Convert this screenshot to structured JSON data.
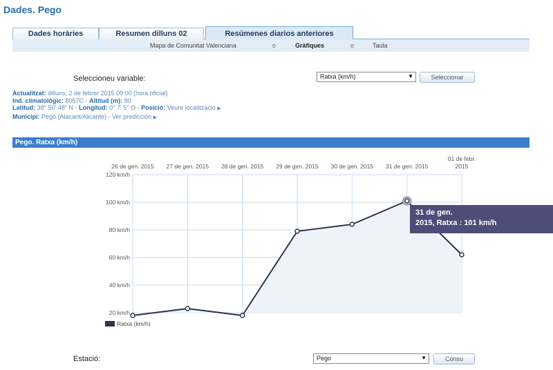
{
  "page_title": "Dades. Pego",
  "tabs": [
    {
      "label": "Dades horàries",
      "active": false
    },
    {
      "label": "Resumen dilluns 02",
      "active": false
    },
    {
      "label": "Resúmenes diarios anteriores",
      "active": true
    }
  ],
  "subnav": {
    "items": [
      "Mapa de Comunitat Valenciana",
      "Gràfiques",
      "Taula"
    ],
    "separator": "o",
    "current": "Gràfiques"
  },
  "variable_selector": {
    "label": "Seleccioneu variable:",
    "selected": "Ratxa (km/h)",
    "button": "Seleccionar"
  },
  "station_info": {
    "updated_label": "Actualitzat:",
    "updated_value": "dilluns, 2 de febrer 2015 09:00 (hora oficial)",
    "ind_label": "Ind. climatològic:",
    "ind_value": "8057C",
    "alt_label": "Altitud (m):",
    "alt_value": "80",
    "lat_label": "Latitud:",
    "lat_value": "38° 50' 48\" N",
    "lon_label": "Longitud:",
    "lon_value": "0° 7' 5\" O",
    "pos_label": "Posició:",
    "pos_link": "Veure localització",
    "muni_label": "Municipi:",
    "muni_value": "Pego (Alacant/Alicante)",
    "pred_link": "Ver predicción",
    "dash": "-"
  },
  "chart_section_title": "Pego. Ratxa (km/h)",
  "chart_data": {
    "type": "line",
    "categories": [
      "26 de gen. 2015",
      "27 de gen. 2015",
      "28 de gen. 2015",
      "29 de gen. 2015",
      "30 de gen. 2015",
      "31 de gen. 2015",
      "01 de febr. 2015"
    ],
    "series": [
      {
        "name": "Ratxa (km/h)",
        "values": [
          18,
          23,
          18,
          79,
          84,
          101,
          62
        ]
      }
    ],
    "ylim": [
      20,
      120
    ],
    "yticks": [
      "20 km/h",
      "40 km/h",
      "60 km/h",
      "80 km/h",
      "100 km/h",
      "120 km/h"
    ],
    "grid": true,
    "legend": "bottom-left",
    "line_color": "#2f3448",
    "tooltip": {
      "line1": "31 de gen.",
      "line2": "2015, Ratxa : 101 km/h"
    }
  },
  "station_selector": {
    "label": "Estació:",
    "selected": "Pego",
    "button": "Consu"
  }
}
